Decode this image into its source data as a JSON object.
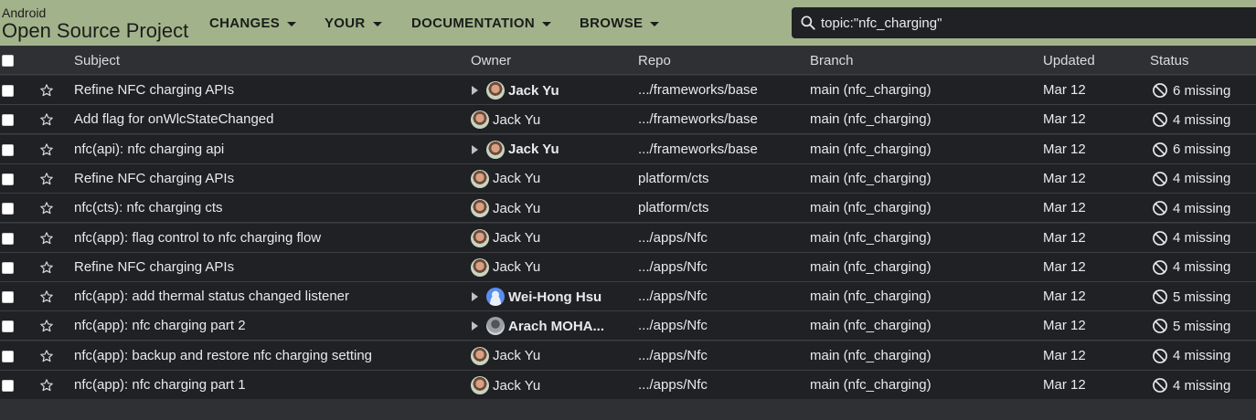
{
  "header": {
    "brand_small": "Android",
    "brand_large": "Open Source Project",
    "nav": [
      "CHANGES",
      "YOUR",
      "DOCUMENTATION",
      "BROWSE"
    ],
    "search_value": "topic:\"nfc_charging\""
  },
  "columns": {
    "subject": "Subject",
    "owner": "Owner",
    "repo": "Repo",
    "branch": "Branch",
    "updated": "Updated",
    "status": "Status"
  },
  "rows": [
    {
      "subject": "Refine NFC charging APIs",
      "owner": "Jack Yu",
      "owner_bold": true,
      "attention": true,
      "avatar": "photo",
      "repo": ".../frameworks/base",
      "branch": "main (nfc_charging)",
      "updated": "Mar 12",
      "status": "6 missing"
    },
    {
      "subject": "Add flag for onWlcStateChanged",
      "owner": "Jack Yu",
      "owner_bold": false,
      "attention": false,
      "avatar": "photo",
      "repo": ".../frameworks/base",
      "branch": "main (nfc_charging)",
      "updated": "Mar 12",
      "status": "4 missing"
    },
    {
      "subject": "nfc(api): nfc charging api",
      "owner": "Jack Yu",
      "owner_bold": true,
      "attention": true,
      "avatar": "photo",
      "repo": ".../frameworks/base",
      "branch": "main (nfc_charging)",
      "updated": "Mar 12",
      "status": "6 missing"
    },
    {
      "subject": "Refine NFC charging APIs",
      "owner": "Jack Yu",
      "owner_bold": false,
      "attention": false,
      "avatar": "photo",
      "repo": "platform/cts",
      "branch": "main (nfc_charging)",
      "updated": "Mar 12",
      "status": "4 missing"
    },
    {
      "subject": "nfc(cts): nfc charging cts",
      "owner": "Jack Yu",
      "owner_bold": false,
      "attention": false,
      "avatar": "photo",
      "repo": "platform/cts",
      "branch": "main (nfc_charging)",
      "updated": "Mar 12",
      "status": "4 missing"
    },
    {
      "subject": "nfc(app): flag control to nfc charging flow",
      "owner": "Jack Yu",
      "owner_bold": false,
      "attention": false,
      "avatar": "photo",
      "repo": ".../apps/Nfc",
      "branch": "main (nfc_charging)",
      "updated": "Mar 12",
      "status": "4 missing"
    },
    {
      "subject": "Refine NFC charging APIs",
      "owner": "Jack Yu",
      "owner_bold": false,
      "attention": false,
      "avatar": "photo",
      "repo": ".../apps/Nfc",
      "branch": "main (nfc_charging)",
      "updated": "Mar 12",
      "status": "4 missing"
    },
    {
      "subject": "nfc(app): add thermal status changed listener",
      "owner": "Wei-Hong Hsu",
      "owner_bold": true,
      "attention": true,
      "avatar": "default",
      "repo": ".../apps/Nfc",
      "branch": "main (nfc_charging)",
      "updated": "Mar 12",
      "status": "5 missing"
    },
    {
      "subject": "nfc(app): nfc charging part 2",
      "owner": "Arach MOHA...",
      "owner_bold": true,
      "attention": true,
      "avatar": "gray",
      "repo": ".../apps/Nfc",
      "branch": "main (nfc_charging)",
      "updated": "Mar 12",
      "status": "5 missing"
    },
    {
      "subject": "nfc(app): backup and restore nfc charging setting",
      "owner": "Jack Yu",
      "owner_bold": false,
      "attention": false,
      "avatar": "photo",
      "repo": ".../apps/Nfc",
      "branch": "main (nfc_charging)",
      "updated": "Mar 12",
      "status": "4 missing"
    },
    {
      "subject": "nfc(app): nfc charging part 1",
      "owner": "Jack Yu",
      "owner_bold": false,
      "attention": false,
      "avatar": "photo",
      "repo": ".../apps/Nfc",
      "branch": "main (nfc_charging)",
      "updated": "Mar 12",
      "status": "4 missing"
    }
  ],
  "colors": {
    "header_bg": "#a2b38b",
    "row_bg": "#202124",
    "page_bg": "#2f3033",
    "text": "#e8eaed"
  }
}
